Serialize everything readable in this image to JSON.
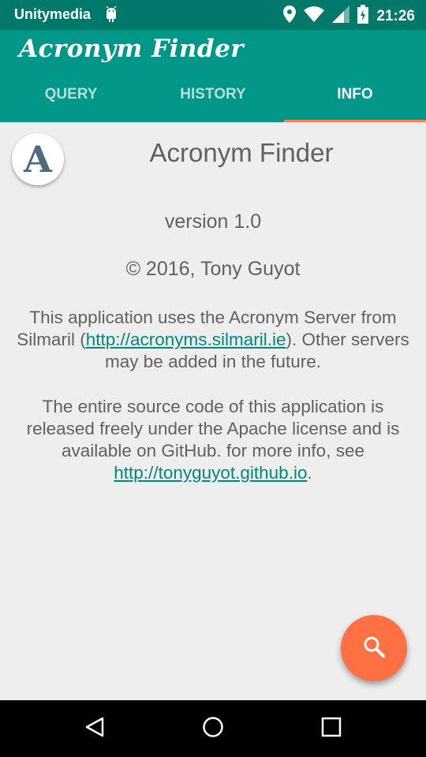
{
  "status_bar": {
    "carrier": "Unitymedia",
    "time": "21:26",
    "icons": [
      "android-debug-icon",
      "location-icon",
      "wifi-icon",
      "signal-icon",
      "battery-icon"
    ]
  },
  "app_bar": {
    "title": "Acronym Finder",
    "tabs": [
      {
        "label": "QUERY",
        "active": false
      },
      {
        "label": "HISTORY",
        "active": false
      },
      {
        "label": "INFO",
        "active": true
      }
    ]
  },
  "info": {
    "logo_letter": "A",
    "app_name": "Acronym Finder",
    "version": "version 1.0",
    "copyright": "© 2016, Tony Guyot",
    "paragraph1": {
      "before": "This application uses the Acronym Server from Silmaril (",
      "link": "http://acronyms.silmaril.ie",
      "after": "). Other servers may be added in the future."
    },
    "paragraph2": {
      "before": "The entire source code of this application is released freely under the Apache license and is available on GitHub. for more info, see ",
      "link": "http://tonyguyot.github.io",
      "after": "."
    }
  },
  "fab": {
    "icon": "search-icon"
  },
  "nav_bar": {
    "icons": [
      "back-icon",
      "home-icon",
      "recents-icon"
    ]
  },
  "colors": {
    "status_bar": "#00796b",
    "app_bar": "#009688",
    "accent": "#ff7043",
    "tab_indicator": "#ff7f5f",
    "link": "#00897b",
    "text": "#616161",
    "background": "#eeeeee"
  }
}
